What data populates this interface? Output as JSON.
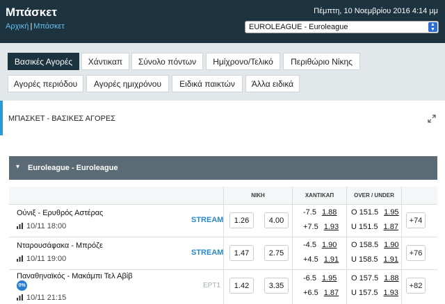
{
  "header": {
    "title": "Μπάσκετ",
    "breadcrumbs": [
      "Αρχική",
      "Μπάσκετ"
    ],
    "date": "Πέμπτη, 10 Νοεμβρίου 2016 4:14 μμ",
    "league_select": "EUROLEAGUE - Euroleague"
  },
  "tabs": {
    "row1": [
      "Βασικές Αγορές",
      "Χάντικαπ",
      "Σύνολο πόντων",
      "Ημίχρονο/Τελικό",
      "Περιθώριο Νίκης"
    ],
    "row2": [
      "Αγορές περιόδου",
      "Αγορές ημιχρόνου",
      "Ειδικά παικτών",
      "Άλλα ειδικά"
    ],
    "active": "Βασικές Αγορές"
  },
  "section": {
    "title": "ΜΠΑΣΚΕΤ - ΒΑΣΙΚΕΣ ΑΓΟΡΕΣ",
    "expand_icon": "expand-arrows-icon"
  },
  "league": {
    "name": "Euroleague - Euroleague"
  },
  "columns": {
    "win": "ΝΙΚΗ",
    "handicap": "ΧΑΝΤΙΚΑΠ",
    "over_under": "OVER / UNDER"
  },
  "matches": [
    {
      "teams": "Ούνιξ - Ερυθρός Αστέρας",
      "datetime": "10/11 18:00",
      "stream": "STREAM",
      "win": [
        "1.26",
        "4.00"
      ],
      "handicap": [
        [
          "-7.5",
          "1.88"
        ],
        [
          "+7.5",
          "1.93"
        ]
      ],
      "over_under": [
        [
          "O 151.5",
          "1.95"
        ],
        [
          "U 151.5",
          "1.87"
        ]
      ],
      "more": "+74"
    },
    {
      "teams": "Νταρουσάφακα - Μπρόζε",
      "datetime": "10/11 19:00",
      "stream": "STREAM",
      "win": [
        "1.47",
        "2.75"
      ],
      "handicap": [
        [
          "-4.5",
          "1.90"
        ],
        [
          "+4.5",
          "1.91"
        ]
      ],
      "over_under": [
        [
          "O 158.5",
          "1.90"
        ],
        [
          "U 158.5",
          "1.91"
        ]
      ],
      "more": "+76"
    },
    {
      "teams": "Παναθηναϊκός - Μακάμπι Τελ Αβίβ",
      "datetime": "10/11 21:15",
      "stream": "ΕΡΤ1",
      "live_badge": "0%",
      "win": [
        "1.42",
        "3.35"
      ],
      "handicap": [
        [
          "-6.5",
          "1.95"
        ],
        [
          "+6.5",
          "1.87"
        ]
      ],
      "over_under": [
        [
          "O 157.5",
          "1.88"
        ],
        [
          "U 157.5",
          "1.93"
        ]
      ],
      "more": "+82"
    }
  ],
  "colors": {
    "header_bg": "#1d3340",
    "accent": "#2a9ad6",
    "league_bar": "#5a6b76",
    "stream": "#2a88c8"
  }
}
